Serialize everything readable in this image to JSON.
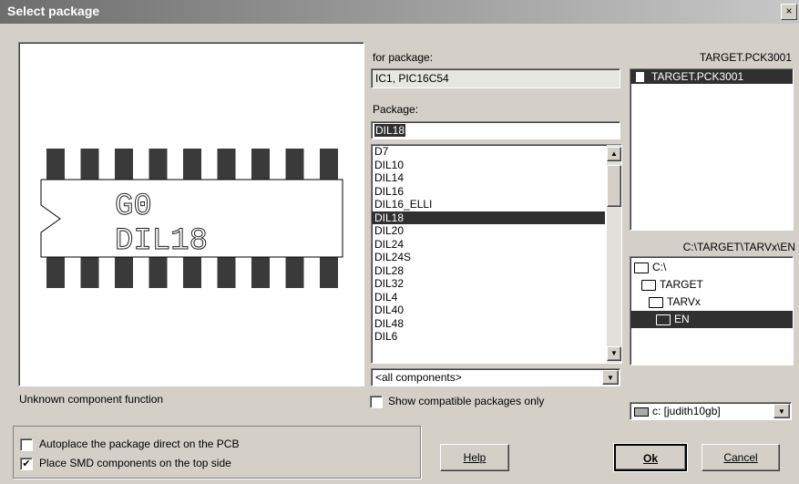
{
  "window": {
    "title": "Select package",
    "close_glyph": "×"
  },
  "preview": {
    "refdes": "G0",
    "package_name": "DIL18",
    "status_text": "Unknown component function"
  },
  "for_package": {
    "label": "for package:",
    "value": "IC1, PIC16C54"
  },
  "package": {
    "label": "Package:",
    "value": "DIL18",
    "items": [
      "D7",
      "DIL10",
      "DIL14",
      "DIL16",
      "DIL16_ELLI",
      "DIL18",
      "DIL20",
      "DIL24",
      "DIL24S",
      "DIL28",
      "DIL32",
      "DIL4",
      "DIL40",
      "DIL48",
      "DIL6"
    ],
    "selected": "DIL18",
    "filter": "<all components>",
    "show_compatible_label": "Show compatible packages only",
    "show_compatible_checked": false
  },
  "library": {
    "header": "TARGET.PCK3001",
    "items": [
      "TARGET.PCK3001"
    ]
  },
  "directory": {
    "header": "C:\\TARGET\\TARVx\\EN",
    "items": [
      {
        "label": "C:\\",
        "level": 0
      },
      {
        "label": "TARGET",
        "level": 1
      },
      {
        "label": "TARVx",
        "level": 2
      },
      {
        "label": "EN",
        "level": 3,
        "selected": true
      }
    ],
    "drive": "c: [judith10gb]"
  },
  "options": {
    "autoplace_label": "Autoplace the package direct on the PCB",
    "autoplace_checked": false,
    "smd_top_label": "Place SMD components on the top side",
    "smd_top_checked": true
  },
  "buttons": {
    "help": "Help",
    "ok": "Ok",
    "cancel": "Cancel"
  }
}
